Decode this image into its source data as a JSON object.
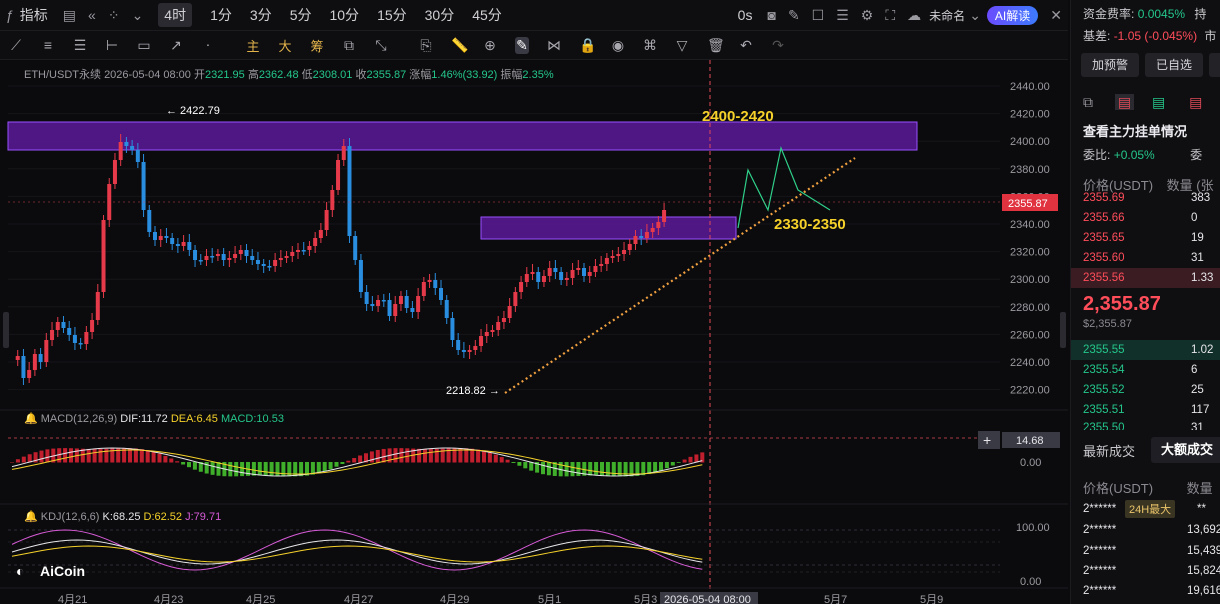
{
  "topbar": {
    "indicator_label": "指标",
    "timeframes": [
      "4时",
      "1分",
      "3分",
      "5分",
      "10分",
      "15分",
      "30分",
      "45分"
    ],
    "countdown": "0s",
    "layout_name": "未命名",
    "ai_label": "AI解读"
  },
  "toolbar": {
    "cn_tools": [
      "主",
      "大",
      "筹"
    ]
  },
  "legend": {
    "symbol": "ETH/USDT永续",
    "datetime": "2026-05-04 08:00",
    "open_label": "开",
    "open": "2321.95",
    "high_label": "高",
    "high": "2362.48",
    "low_label": "低",
    "low": "2308.01",
    "close_label": "收",
    "close": "2355.87",
    "change_label": "涨幅",
    "change": "1.46%(33.92)",
    "amp_label": "振幅",
    "amp": "2.35%"
  },
  "macd_legend": {
    "name": "MACD(12,26,9)",
    "dif": "DIF:11.72",
    "dea": "DEA:6.45",
    "macd": "MACD:10.53"
  },
  "kdj_legend": {
    "name": "KDJ(12,6,6)",
    "k": "K:68.25",
    "d": "D:62.52",
    "j": "J:79.71"
  },
  "annotations": {
    "high_mark": "← 2422.79",
    "low_mark": "2218.82 →",
    "resistance_label": "2400-2420",
    "support_label": "2330-2350"
  },
  "price_axis": [
    "2440.00",
    "2420.00",
    "2400.00",
    "2380.00",
    "2360.00",
    "2340.00",
    "2320.00",
    "2300.00",
    "2280.00",
    "2260.00",
    "2240.00",
    "2220.00"
  ],
  "current_price_tag": "2355.87",
  "macd_axis": {
    "tag": "14.68",
    "zero": "0.00"
  },
  "kdj_axis": {
    "top": "100.00",
    "bottom": "0.00"
  },
  "date_axis": [
    "4月21",
    "4月23",
    "4月25",
    "4月27",
    "4月29",
    "5月1",
    "5月3",
    "5月7",
    "5月9"
  ],
  "date_tag": "2026-05-04 08:00",
  "watermark": "AiCoin",
  "right_panel": {
    "funding_label": "资金费率:",
    "funding_value": "0.0045%",
    "funding_extra": "持",
    "basis_label": "基差:",
    "basis_value": "-1.05 (-0.045%)",
    "basis_extra": "市",
    "btn_alert": "加预警",
    "btn_selected": "已自选",
    "orders_title": "查看主力挂单情况",
    "ratio_label": "委比:",
    "ratio_value": "+0.05%",
    "ratio_extra": "委",
    "col_price": "价格(USDT)",
    "col_qty": "数量 (张",
    "asks": [
      {
        "price": "2355.69",
        "qty": "383"
      },
      {
        "price": "2355.66",
        "qty": "0"
      },
      {
        "price": "2355.65",
        "qty": "19"
      },
      {
        "price": "2355.60",
        "qty": "31"
      },
      {
        "price": "2355.56",
        "qty": "1.33"
      }
    ],
    "last_price": "2,355.87",
    "last_usd": "$2,355.87",
    "bids": [
      {
        "price": "2355.55",
        "qty": "1.02"
      },
      {
        "price": "2355.54",
        "qty": "6"
      },
      {
        "price": "2355.52",
        "qty": "25"
      },
      {
        "price": "2355.51",
        "qty": "117"
      },
      {
        "price": "2355.50",
        "qty": "31"
      }
    ],
    "tab_latest": "最新成交",
    "tab_large": "大额成交",
    "trades_col_price": "价格(USDT)",
    "trades_col_qty": "数量",
    "badge": "24H最大",
    "trades": [
      {
        "price": "2******",
        "qty": "**"
      },
      {
        "price": "2******",
        "qty": "13,692"
      },
      {
        "price": "2******",
        "qty": "15,439"
      },
      {
        "price": "2******",
        "qty": "15,824"
      },
      {
        "price": "2******",
        "qty": "19,616"
      }
    ]
  }
}
